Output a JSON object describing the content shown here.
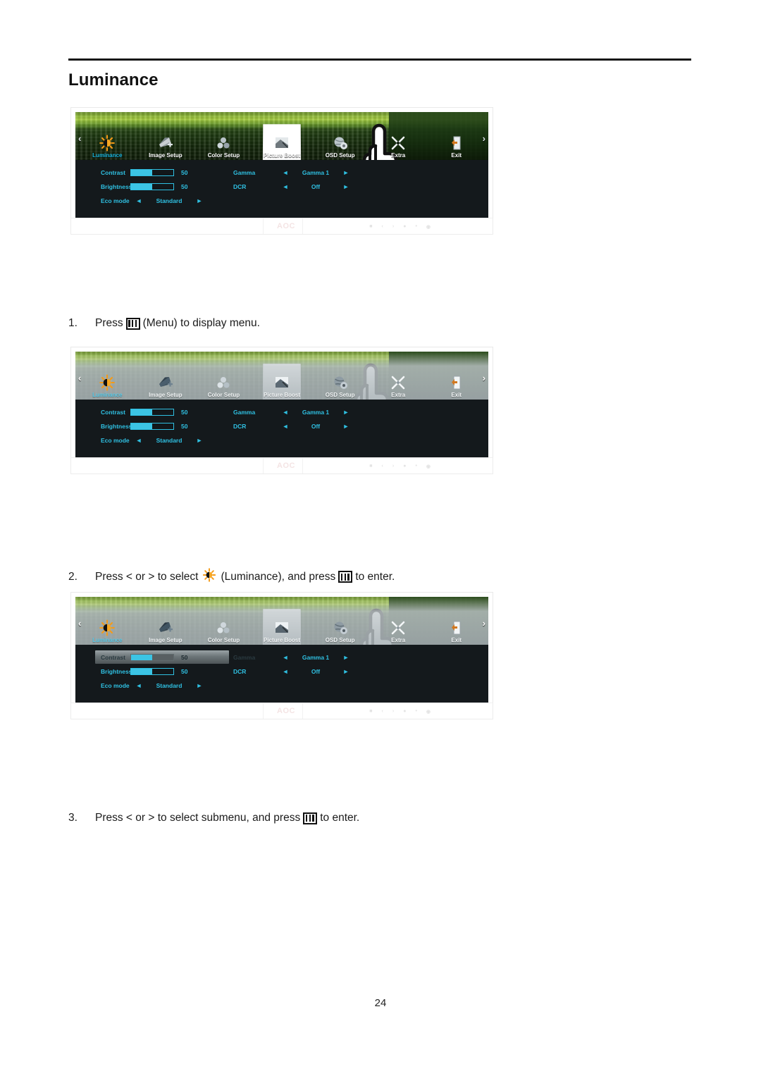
{
  "document": {
    "title": "Luminance",
    "page_number": "24"
  },
  "osd": {
    "menu_items": [
      {
        "label": "Luminance",
        "icon": "sun-icon"
      },
      {
        "label": "Image Setup",
        "icon": "image-setup-icon"
      },
      {
        "label": "Color Setup",
        "icon": "color-setup-icon"
      },
      {
        "label": "Picture Boost",
        "icon": "picture-boost-icon"
      },
      {
        "label": "OSD Setup",
        "icon": "osd-setup-icon"
      },
      {
        "label": "Extra",
        "icon": "extra-tools-icon"
      },
      {
        "label": "Exit",
        "icon": "exit-door-icon"
      }
    ],
    "nav_left": "‹",
    "nav_right": "›",
    "arrow_left": "◄",
    "arrow_right": "►",
    "settings": {
      "contrast": {
        "label": "Contrast",
        "value": "50",
        "percent": 50
      },
      "brightness": {
        "label": "Brightness",
        "value": "50",
        "percent": 50
      },
      "eco_mode": {
        "label": "Eco mode",
        "value": "Standard"
      },
      "gamma": {
        "label": "Gamma",
        "value": "Gamma 1"
      },
      "dcr": {
        "label": "DCR",
        "value": "Off"
      }
    },
    "brand": "AOC",
    "accent_color": "#2fc0e2",
    "panel_color": "#14191c"
  },
  "steps": [
    {
      "num": "1.",
      "before": "Press ",
      "middle": " (Menu) to display menu.",
      "after": ""
    },
    {
      "num": "2.",
      "before": "Press < or > to select ",
      "middle": " (Luminance), and press ",
      "after": " to enter."
    },
    {
      "num": "3.",
      "before": "Press < or > to select submenu, and press ",
      "middle": " to enter.",
      "after": ""
    }
  ]
}
